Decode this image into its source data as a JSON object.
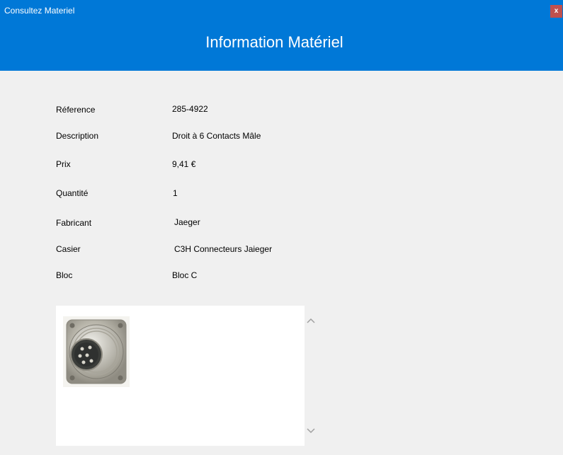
{
  "window": {
    "title": "Consultez Materiel",
    "close_label": "x"
  },
  "header": {
    "title": "Information Matériel"
  },
  "fields": [
    {
      "label": "Réference",
      "value": "285-4922"
    },
    {
      "label": "Description",
      "value": "Droit à 6 Contacts Mâle"
    },
    {
      "label": "Prix",
      "value": "9,41 €"
    },
    {
      "label": "Quantité",
      "value": "1"
    },
    {
      "label": "Fabricant",
      "value": "Jaeger"
    },
    {
      "label": "Casier",
      "value": "C3H Connecteurs Jaieger"
    },
    {
      "label": "Bloc",
      "value": "Bloc C"
    }
  ],
  "image_panel": {
    "image": "connector-photo",
    "scroll_up_icon": "chevron-up-icon",
    "scroll_down_icon": "chevron-down-icon"
  },
  "colors": {
    "header_bg": "#0078d7",
    "close_bg": "#c0504d",
    "body_bg": "#f0f0f0"
  }
}
